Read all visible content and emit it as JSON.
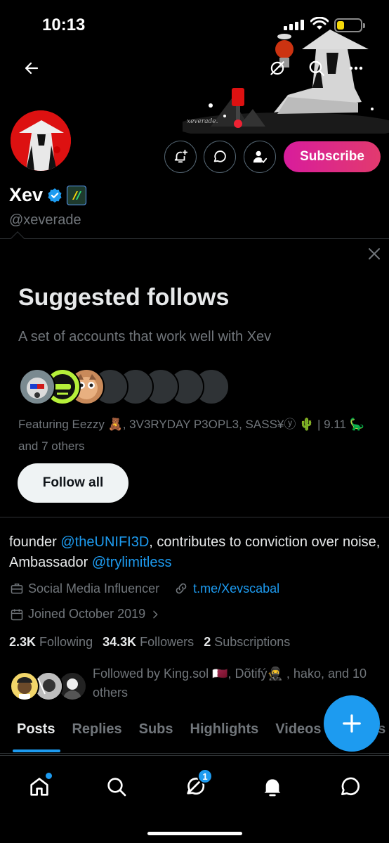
{
  "status_bar": {
    "time": "10:13",
    "battery_level": 0.3
  },
  "banner": {
    "signature": "xeverade."
  },
  "profile": {
    "display_name": "Xev",
    "handle": "@xeverade",
    "subscribe_label": "Subscribe",
    "bio_prefix": "founder ",
    "bio_mention_1": "@theUNIFI3D",
    "bio_middle": ", contributes to conviction over noise, Ambassador ",
    "bio_mention_2": "@trylimitless",
    "category": "Social Media Influencer",
    "website": "t.me/Xevscabal",
    "joined": "Joined October 2019",
    "following_count": "2.3K",
    "following_label": "Following",
    "followers_count": "34.3K",
    "followers_label": "Followers",
    "subscriptions_count": "2",
    "subscriptions_label": "Subscriptions",
    "followed_by": "Followed by King.sol 🇶🇦, Dõtifý🥷 , hako, and 10 others"
  },
  "suggested": {
    "title": "Suggested follows",
    "subtitle": "A set of accounts that work well with Xev",
    "featuring": "Featuring Eezzy 🧸, 3V3RYDAY P3OPL3, SASS¥ⓨ 🌵 | 9.11 🦕 and 7 others",
    "follow_all_label": "Follow all"
  },
  "tabs": [
    {
      "label": "Posts",
      "active": true
    },
    {
      "label": "Replies",
      "active": false
    },
    {
      "label": "Subs",
      "active": false
    },
    {
      "label": "Highlights",
      "active": false
    },
    {
      "label": "Videos",
      "active": false
    },
    {
      "label": "Photos",
      "active": false
    }
  ],
  "bottom_nav": {
    "items": [
      "home-icon",
      "search-icon",
      "grok-icon",
      "notifications-icon",
      "messages-icon"
    ],
    "grok_badge": "1"
  },
  "colors": {
    "accent": "#1d9bf0",
    "subscribe_gradient_start": "#d81c9c",
    "subscribe_gradient_end": "#e23a6e",
    "muted_text": "#71767b"
  }
}
